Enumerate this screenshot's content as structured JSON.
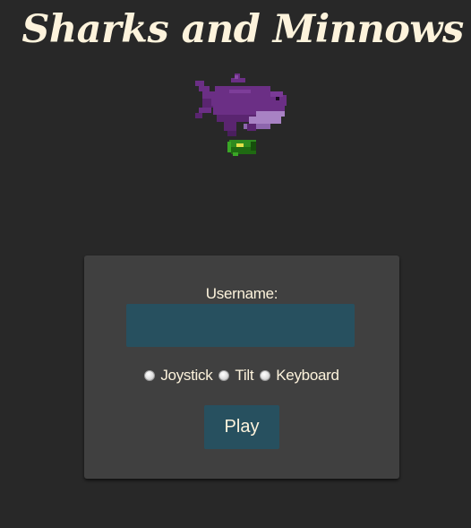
{
  "title": "Sharks and Minnows",
  "mascot": {
    "icon": "pixel-shark-eating-minnow-icon",
    "shark_color": "#6b2f85",
    "belly_color": "#a882c4",
    "minnow_color": "#2e8b1f"
  },
  "form": {
    "username_label": "Username:",
    "username_value": "",
    "username_placeholder": "",
    "control_options": [
      {
        "label": "Joystick",
        "selected": false
      },
      {
        "label": "Tilt",
        "selected": false
      },
      {
        "label": "Keyboard",
        "selected": false
      }
    ],
    "play_label": "Play"
  },
  "colors": {
    "background": "#282828",
    "panel": "#404040",
    "accent": "#27505f",
    "text": "#fdf3dc"
  }
}
